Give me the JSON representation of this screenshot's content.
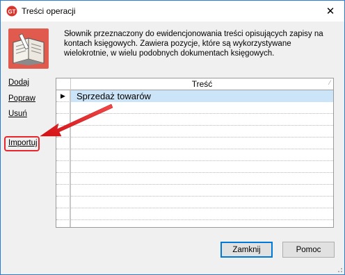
{
  "window": {
    "title": "Treści operacji",
    "close_symbol": "✕"
  },
  "description": "Słownik przeznaczony do ewidencjonowania treści opisujących zapisy na kontach księgowych. Zawiera pozycje, które są wykorzystywane wielokrotnie, w wielu podobnych dokumentach księgowych.",
  "sidebar": {
    "add": "Dodaj",
    "edit": "Popraw",
    "delete": "Usuń",
    "import": "Importuj"
  },
  "grid": {
    "column_header": "Treść",
    "rows": [
      {
        "text": "Sprzedaż towarów",
        "selected": true,
        "indicator": "▶"
      },
      {
        "text": ""
      },
      {
        "text": ""
      },
      {
        "text": ""
      },
      {
        "text": ""
      },
      {
        "text": ""
      },
      {
        "text": ""
      },
      {
        "text": ""
      },
      {
        "text": ""
      },
      {
        "text": ""
      },
      {
        "text": ""
      },
      {
        "text": ""
      }
    ]
  },
  "buttons": {
    "close": "Zamknij",
    "help": "Pomoc"
  },
  "colors": {
    "annotation_red": "#e8262b",
    "selection": "#cce4f7",
    "logo_bg": "#e05a4e"
  },
  "icons": {
    "app": "app-logo-icon",
    "book": "open-book-icon",
    "row_indicator": "row-pointer-icon",
    "annotation": "red-arrow"
  }
}
